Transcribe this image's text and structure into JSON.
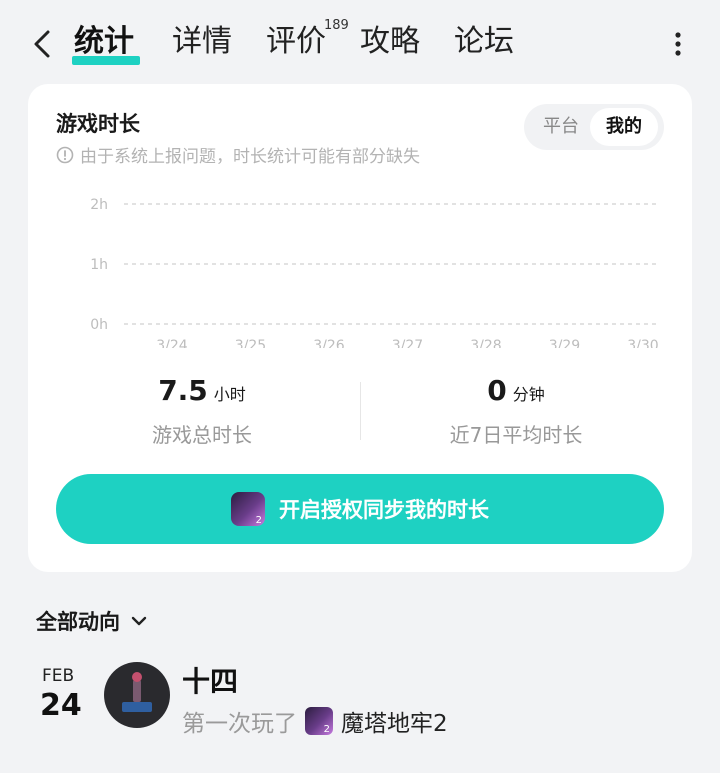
{
  "nav": {
    "tabs": [
      {
        "label": "统计",
        "active": true
      },
      {
        "label": "详情"
      },
      {
        "label": "评价",
        "badge": "189"
      },
      {
        "label": "攻略"
      },
      {
        "label": "论坛"
      }
    ]
  },
  "card": {
    "title": "游戏时长",
    "notice": "由于系统上报问题，时长统计可能有部分缺失",
    "segment": {
      "options": [
        "平台",
        "我的"
      ],
      "selected": "我的"
    }
  },
  "chart_data": {
    "type": "line",
    "categories": [
      "3/24",
      "3/25",
      "3/26",
      "3/27",
      "3/28",
      "3/29",
      "3/30"
    ],
    "values": [
      0,
      0,
      0,
      0,
      0,
      0,
      0
    ],
    "yticks": [
      "0h",
      "1h",
      "2h"
    ],
    "ylim": [
      0,
      2
    ],
    "grid": true
  },
  "stats": {
    "total": {
      "value": "7.5",
      "unit": "小时",
      "label": "游戏总时长"
    },
    "avg": {
      "value": "0",
      "unit": "分钟",
      "label": "近7日平均时长"
    }
  },
  "sync_button": {
    "label": "开启授权同步我的时长"
  },
  "feed": {
    "filter_label": "全部动向",
    "item": {
      "month": "FEB",
      "day": "24",
      "name": "十四",
      "action": "第一次玩了",
      "game": "魔塔地牢2"
    }
  },
  "colors": {
    "accent": "#1ed1c2",
    "muted": "#999999"
  }
}
